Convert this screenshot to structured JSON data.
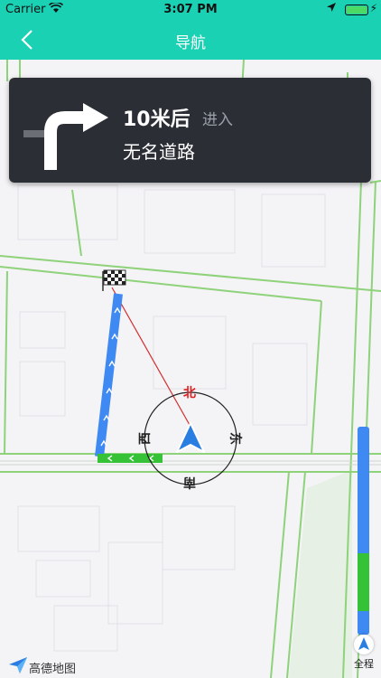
{
  "status_bar": {
    "carrier": "Carrier",
    "time": "3:07 PM"
  },
  "nav_bar": {
    "title": "导航"
  },
  "instruction": {
    "distance": "10米后",
    "action": "进入",
    "road": "无名道路"
  },
  "compass": {
    "north": "北",
    "east": "东",
    "south": "南",
    "west": "西"
  },
  "route_overview": {
    "label": "全程"
  },
  "logo": {
    "text": "高德地图"
  },
  "colors": {
    "header": "#1ad1b4",
    "panel": "#2b2e35",
    "route_blue": "#3f89f2",
    "route_green": "#36c237",
    "road_green": "#8ed27a",
    "north_red": "#e02020"
  }
}
